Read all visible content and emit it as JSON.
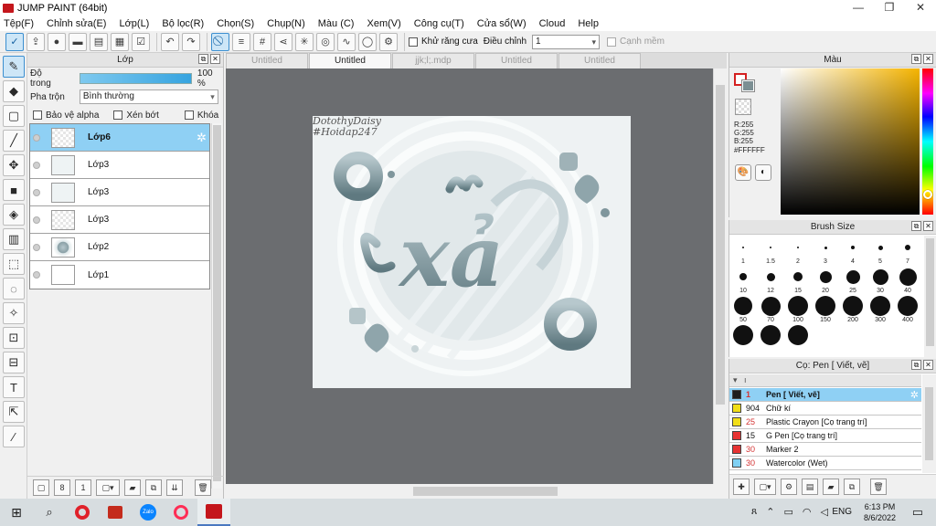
{
  "window": {
    "title": "JUMP PAINT (64bit)",
    "controls": [
      "—",
      "❐",
      "✕"
    ]
  },
  "menu": [
    "Tệp(F)",
    "Chỉnh sửa(E)",
    "Lớp(L)",
    "Bộ lọc(R)",
    "Chọn(S)",
    "Chụp(N)",
    "Màu (C)",
    "Xem(V)",
    "Công cụ(T)",
    "Cửa sổ(W)",
    "Cloud",
    "Help"
  ],
  "toolbar": {
    "antialias_label": "Khử răng cưa",
    "adjust_label": "Điều chỉnh",
    "adjust_value": "1",
    "edge_label": "Cạnh mềm"
  },
  "layer_panel": {
    "title": "Lớp",
    "opacity_label": "Độ trong",
    "opacity_value": "100 %",
    "opacity": 1.0,
    "blend_label": "Pha trộn",
    "blend_value": "Bình thường",
    "protect_alpha": "Bảo vệ alpha",
    "clipping": "Xén bớt",
    "lock": "Khóa",
    "layers": [
      {
        "name": "Lớp6",
        "selected": true,
        "thumb": "transparent"
      },
      {
        "name": "Lớp3",
        "selected": false,
        "thumb": "sketch"
      },
      {
        "name": "Lớp3",
        "selected": false,
        "thumb": "sketch"
      },
      {
        "name": "Lớp3",
        "selected": false,
        "thumb": "transparent"
      },
      {
        "name": "Lớp2",
        "selected": false,
        "thumb": "image"
      },
      {
        "name": "Lớp1",
        "selected": false,
        "thumb": "white"
      }
    ]
  },
  "tabs": [
    {
      "label": "Untitled",
      "active": false
    },
    {
      "label": "Untitled",
      "active": true
    },
    {
      "label": "jjk;l;.mdp",
      "active": false
    },
    {
      "label": "Untitled",
      "active": false
    },
    {
      "label": "Untitled",
      "active": false
    }
  ],
  "canvas": {
    "signature_line1": "DotothyDaisy",
    "signature_line2": "#Hoidap247",
    "artwork_text": "xả"
  },
  "color_panel": {
    "title": "Màu",
    "r": "R:255",
    "g": "G:255",
    "b": "B:255",
    "hex": "#FFFFFF",
    "fg_color": "#ffffff",
    "bg_color": "#7c8f93"
  },
  "brush_panel": {
    "title": "Brush Size",
    "sizes": [
      "1",
      "1.5",
      "2",
      "3",
      "4",
      "5",
      "7",
      "10",
      "12",
      "15",
      "20",
      "25",
      "30",
      "40",
      "50",
      "70",
      "100",
      "150",
      "200",
      "300",
      "400",
      "",
      "",
      ""
    ]
  },
  "tool_panel": {
    "title": "Cọ: Pen [ Viết, vẽ]",
    "items": [
      {
        "num": "1",
        "name": "Pen [ Viết, vẽ]",
        "color": "#1e1e1e",
        "selected": true
      },
      {
        "num": "904",
        "name": "Chữ kí",
        "color": "#f1de17",
        "selected": false
      },
      {
        "num": "25",
        "name": "Plastic Crayon [Cọ trang trí]",
        "color": "#f1de17",
        "selected": false
      },
      {
        "num": "15",
        "name": "G Pen [Cọ trang trí]",
        "color": "#e73333",
        "selected": false
      },
      {
        "num": "30",
        "name": "Marker 2",
        "color": "#e73333",
        "selected": false
      },
      {
        "num": "30",
        "name": "Watercolor (Wet)",
        "color": "#7fd0f3",
        "selected": false
      }
    ]
  },
  "taskbar": {
    "time": "6:13 PM",
    "date": "8/6/2022",
    "language": "ENG",
    "apps": [
      "windows-start",
      "search",
      "opera",
      "snip",
      "zalo",
      "opera-gx",
      "jump-paint"
    ]
  }
}
